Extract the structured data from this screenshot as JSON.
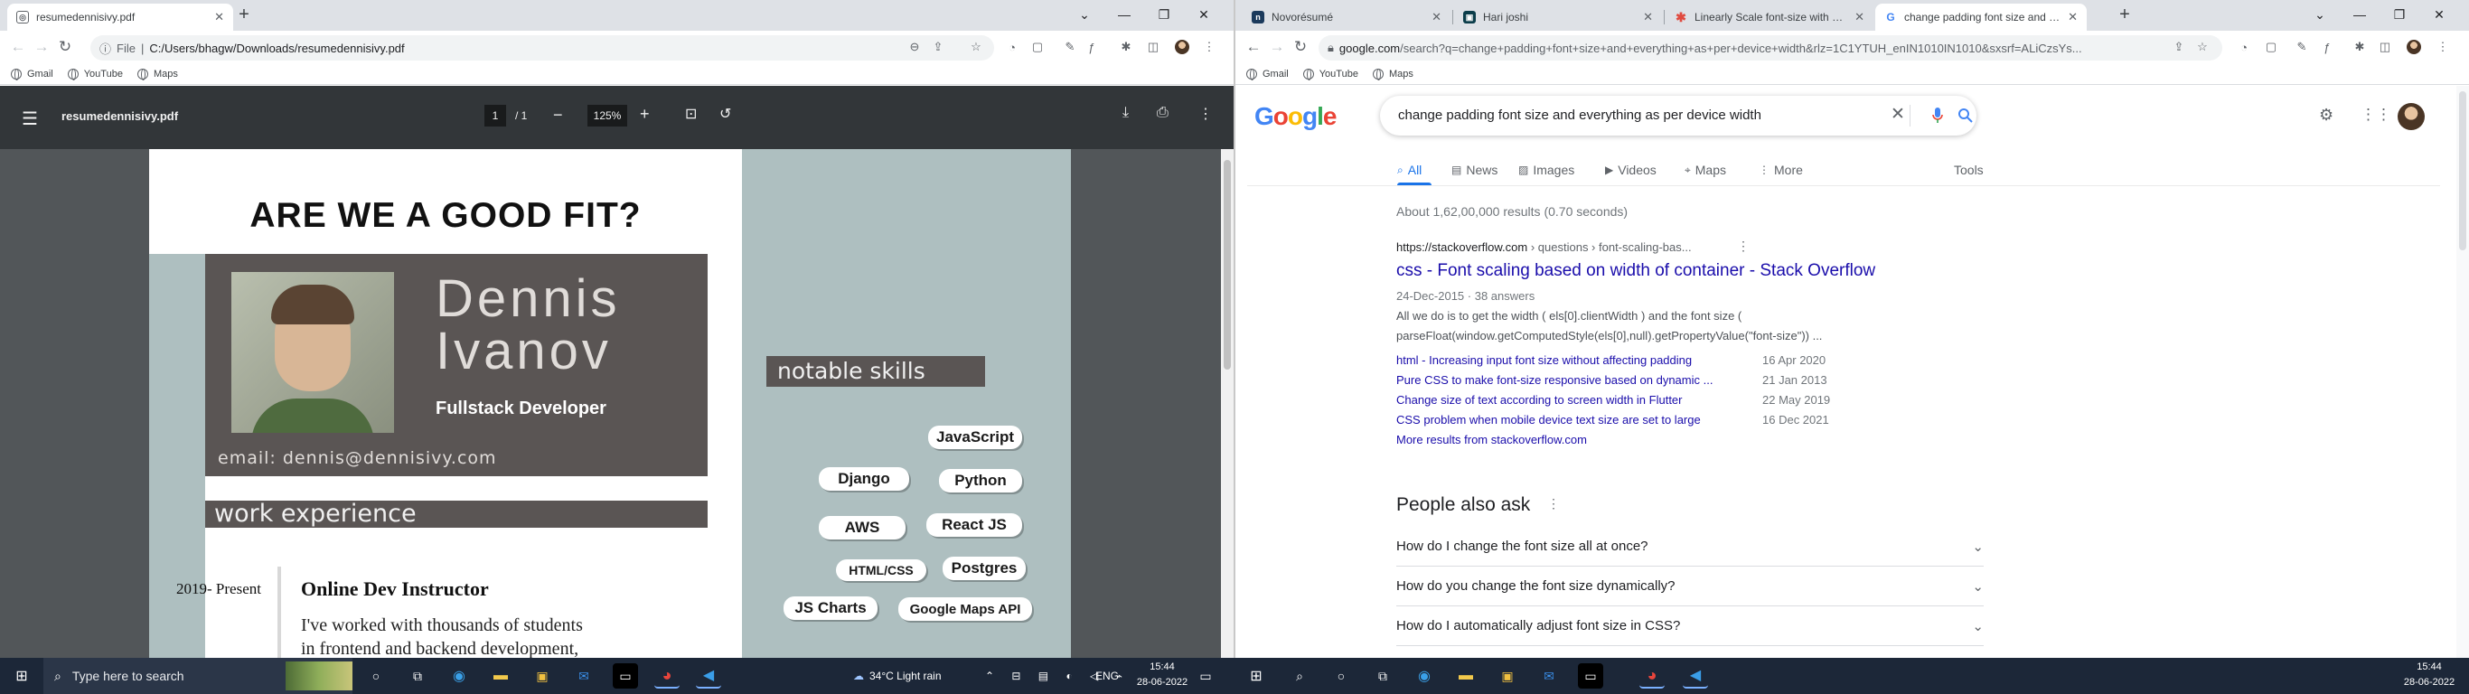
{
  "left": {
    "tab": {
      "title": "resumedennisivy.pdf"
    },
    "address": {
      "prefix": "File",
      "url": "C:/Users/bhagw/Downloads/resumedennisivy.pdf"
    },
    "bookmarks": [
      "Gmail",
      "YouTube",
      "Maps"
    ],
    "pdf": {
      "filename": "resumedennisivy.pdf",
      "page_current": "1",
      "page_total": "/ 1",
      "zoom": "125%"
    },
    "resume": {
      "heading": "ARE WE A GOOD FIT?",
      "first_name": "Dennis",
      "last_name": "Ivanov",
      "role": "Fullstack Developer",
      "email": "email: dennis@dennisivy.com",
      "work_title": "work experience",
      "skills_title": "notable skills",
      "job_period": "2019- Present",
      "job_title": "Online Dev Instructor",
      "job_desc_1": "I've worked with thousands of students",
      "job_desc_2": "in frontend and backend development,",
      "skills": [
        "JavaScript",
        "Django",
        "Python",
        "AWS",
        "React JS",
        "HTML/CSS",
        "Postgres",
        "JS Charts",
        "Google Maps API"
      ]
    }
  },
  "right": {
    "tabs": [
      {
        "title": "Novorésumé",
        "color": "#1b3a5c"
      },
      {
        "title": "Hari joshi",
        "color": "#0b3d4a"
      },
      {
        "title": "Linearly Scale font-size with CSS clamp() Based on the Viewport",
        "color": "#e04a3f"
      },
      {
        "title": "change padding font size and every",
        "color": "#4285f4"
      }
    ],
    "address": {
      "host": "google.com",
      "path": "/search?q=change+padding+font+size+and+everything+as+per+device+width&rlz=1C1YTUH_enIN1010IN1010&sxsrf=ALiCzsYs..."
    },
    "bookmarks": [
      "Gmail",
      "YouTube",
      "Maps"
    ],
    "search": {
      "query": "change padding font size and everything as per device width",
      "tabs": [
        "All",
        "News",
        "Images",
        "Videos",
        "Maps",
        "More"
      ],
      "tools": "Tools",
      "stats": "About 1,62,00,000 results (0.70 seconds)",
      "result": {
        "url": "https://stackoverflow.com",
        "crumbs": "› questions › font-scaling-bas...",
        "title": "css - Font scaling based on width of container - Stack Overflow",
        "date": "24-Dec-2015",
        "answers": "38 answers",
        "snippet_1": "All we do is to get the width ( els[0].clientWidth ) and the font size (",
        "snippet_2": "parseFloat(window.getComputedStyle(els[0],null).getPropertyValue(\"font-size\")) ...",
        "sublinks": [
          {
            "text": "html - Increasing input font size without affecting padding",
            "date": "16 Apr 2020"
          },
          {
            "text": "Pure CSS to make font-size responsive based on dynamic ...",
            "date": "21 Jan 2013"
          },
          {
            "text": "Change size of text according to screen width in Flutter",
            "date": "22 May 2019"
          },
          {
            "text": "CSS problem when mobile device text size are set to large",
            "date": "16 Dec 2021"
          }
        ],
        "more": "More results from stackoverflow.com"
      },
      "paa_title": "People also ask",
      "paa": [
        "How do I change the font size all at once?",
        "How do you change the font size dynamically?",
        "How do I automatically adjust font size in CSS?"
      ]
    }
  },
  "taskbar": {
    "search_placeholder": "Type here to search",
    "weather": "34°C  Light rain",
    "lang": "ENG",
    "time": "15:44",
    "date": "28-06-2022",
    "time2": "15:44",
    "date2": "28-06-2022"
  },
  "colors": {
    "resume_accent": "#aebfc0",
    "card": "#5a5554",
    "google_link": "#1a0dab",
    "taskbar": "#1c2738"
  }
}
